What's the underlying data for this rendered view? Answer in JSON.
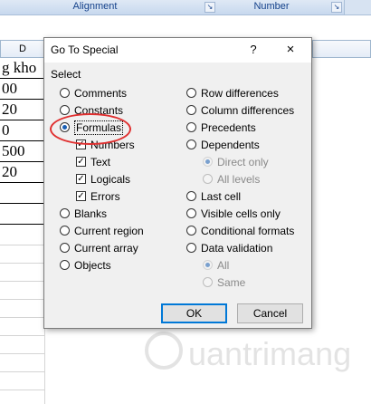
{
  "ribbon": {
    "groups": [
      {
        "label": "Alignment"
      },
      {
        "label": "Number"
      }
    ]
  },
  "sheet": {
    "column_header": "D",
    "cells": [
      "g kho",
      "00",
      "20",
      "0",
      "500",
      "20"
    ]
  },
  "dialog": {
    "title": "Go To Special",
    "help_label": "?",
    "close_label": "×",
    "section_label": "Select",
    "left_options": [
      {
        "label": "Comments",
        "selected": false
      },
      {
        "label": "Constants",
        "selected": false
      },
      {
        "label": "Formulas",
        "selected": true
      }
    ],
    "formula_checks": [
      {
        "label": "Numbers",
        "checked": true
      },
      {
        "label": "Text",
        "checked": true
      },
      {
        "label": "Logicals",
        "checked": true
      },
      {
        "label": "Errors",
        "checked": true
      }
    ],
    "left_options_2": [
      {
        "label": "Blanks",
        "selected": false
      },
      {
        "label": "Current region",
        "selected": false
      },
      {
        "label": "Current array",
        "selected": false
      },
      {
        "label": "Objects",
        "selected": false
      }
    ],
    "right_options": [
      {
        "label": "Row differences",
        "selected": false
      },
      {
        "label": "Column differences",
        "selected": false
      },
      {
        "label": "Precedents",
        "selected": false
      },
      {
        "label": "Dependents",
        "selected": false
      }
    ],
    "dependents_sub": [
      {
        "label": "Direct only",
        "selected": true,
        "disabled": true
      },
      {
        "label": "All levels",
        "selected": false,
        "disabled": true
      }
    ],
    "right_options_2": [
      {
        "label": "Last cell",
        "selected": false
      },
      {
        "label": "Visible cells only",
        "selected": false
      },
      {
        "label": "Conditional formats",
        "selected": false
      },
      {
        "label": "Data validation",
        "selected": false
      }
    ],
    "validation_sub": [
      {
        "label": "All",
        "selected": true,
        "disabled": true
      },
      {
        "label": "Same",
        "selected": false,
        "disabled": true
      }
    ],
    "ok_label": "OK",
    "cancel_label": "Cancel"
  },
  "watermark": {
    "text": "uantrimang"
  },
  "colors": {
    "highlight": "#e03030",
    "accent": "#0078d7"
  }
}
